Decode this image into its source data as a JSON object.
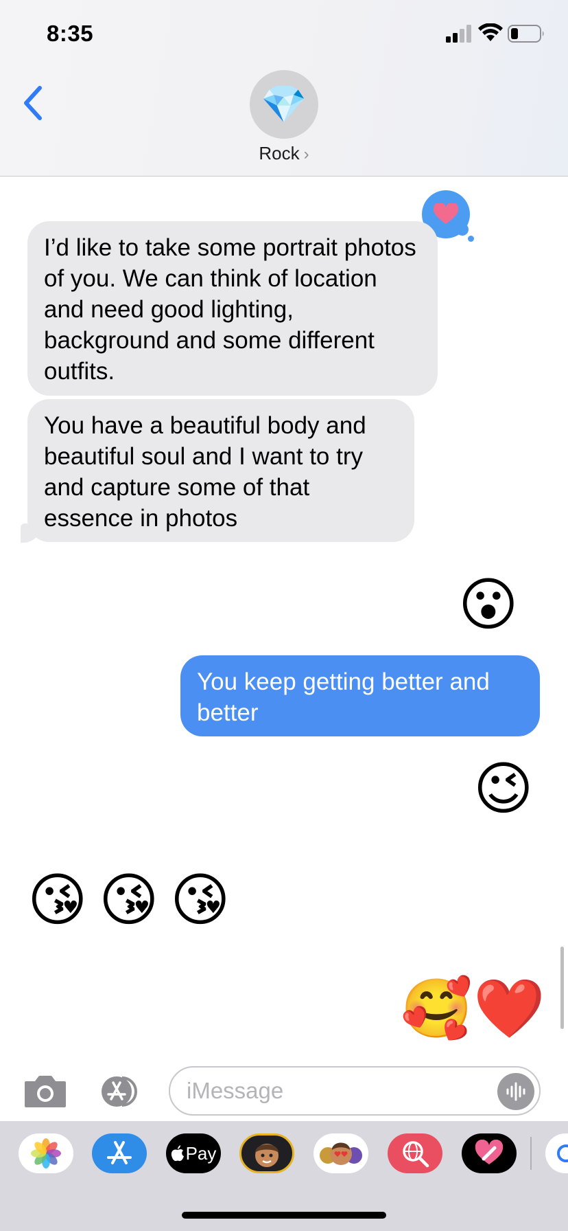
{
  "status_bar": {
    "time": "8:35"
  },
  "header": {
    "contact_name": "Rock",
    "avatar_emoji": "💎",
    "chevron": "›"
  },
  "messages": {
    "received_1": "I’d like to take some portrait photos of you. We can think of location and need good lighting, background and some different outfits.",
    "received_2": "You have a beautiful body and beautiful soul and I want to try and capture some of that essence in photos",
    "tapback_icon": "heart-icon",
    "sent_emoji_1": "😮",
    "sent_text": "You keep getting better and better",
    "sent_emoji_2": "😉",
    "received_emojis": [
      "😘",
      "😘",
      "😘"
    ],
    "sent_emoji_3": "🥰",
    "sent_emoji_4": "❤️"
  },
  "input_bar": {
    "placeholder": "iMessage"
  },
  "app_drawer": {
    "apple_pay_label": "Pay",
    "apps": [
      "photos-icon",
      "app-store-icon",
      "apple-pay-icon",
      "memoji-icon",
      "animoji-icon",
      "web-search-icon",
      "digital-touch-icon"
    ]
  },
  "colors": {
    "sent_bubble": "#4c8ff2",
    "received_bubble": "#e9e9eb",
    "accent": "#2f7cf6"
  }
}
